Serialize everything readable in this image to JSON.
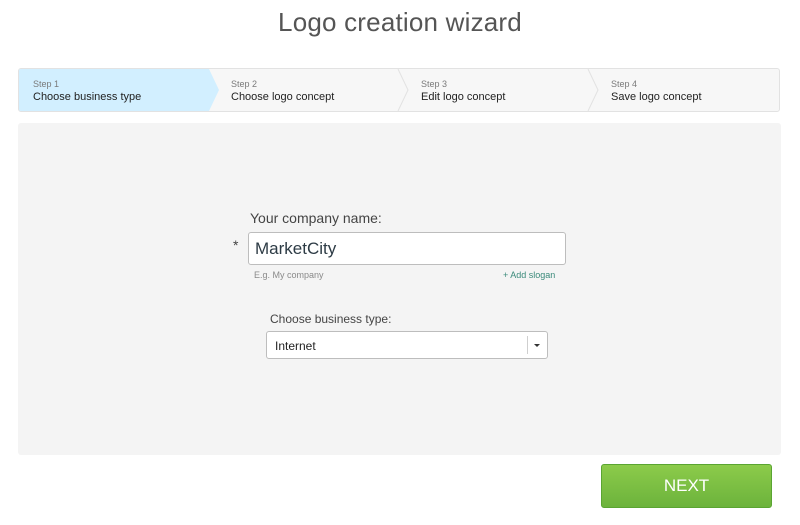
{
  "page": {
    "title": "Logo creation wizard"
  },
  "steps": [
    {
      "number": "Step 1",
      "label": "Choose business type",
      "active": true
    },
    {
      "number": "Step 2",
      "label": "Choose logo concept",
      "active": false
    },
    {
      "number": "Step 3",
      "label": "Edit logo concept",
      "active": false
    },
    {
      "number": "Step 4",
      "label": "Save logo concept",
      "active": false
    }
  ],
  "form": {
    "company_label": "Your company name:",
    "required_mark": "*",
    "company_value": "MarketCity",
    "company_hint": "E.g. My company",
    "add_slogan": "+ Add slogan",
    "business_label": "Choose business type:",
    "business_selected": "Internet"
  },
  "actions": {
    "next_label": "NEXT"
  },
  "colors": {
    "active_step": "#d2efff",
    "next_button": "#7cc043",
    "link": "#3a8a7a",
    "panel": "#f4f4f4"
  },
  "icons": {
    "select_caret": "caret-down-icon",
    "step_separator": "chevron-right-icon"
  }
}
